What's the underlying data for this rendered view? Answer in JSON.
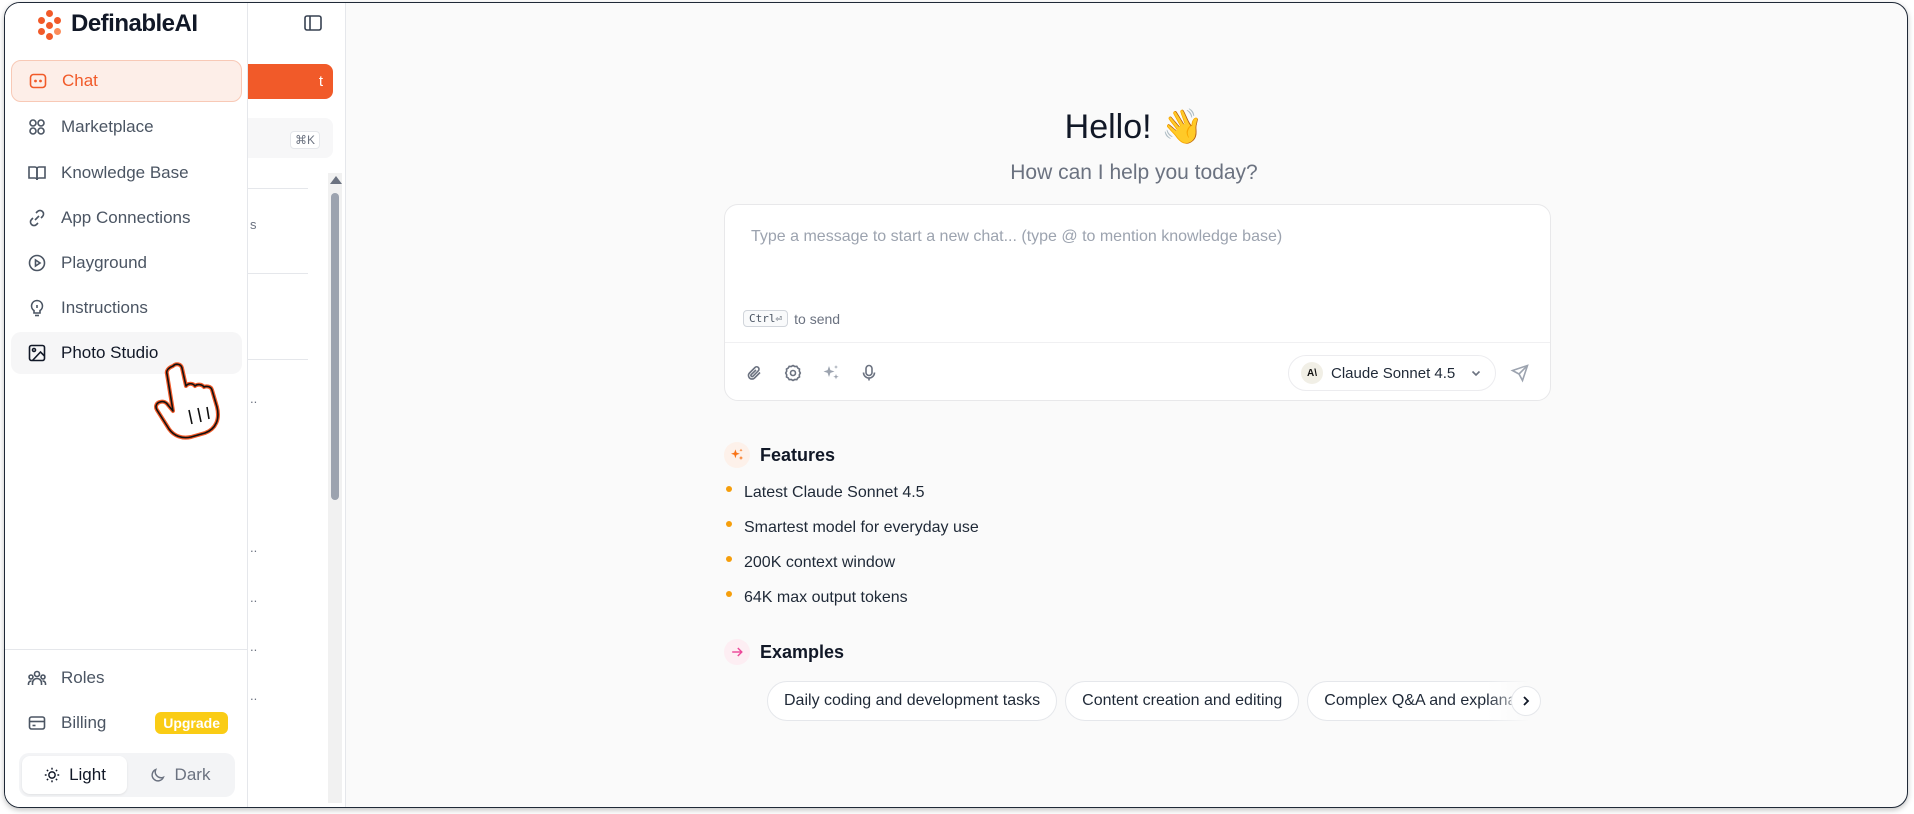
{
  "app": {
    "name": "DefinableAI"
  },
  "nav": {
    "items": [
      {
        "label": "Chat",
        "icon": "chat-bubble-icon",
        "state": "active"
      },
      {
        "label": "Marketplace",
        "icon": "grid-icon"
      },
      {
        "label": "Knowledge Base",
        "icon": "book-open-icon"
      },
      {
        "label": "App Connections",
        "icon": "link-icon"
      },
      {
        "label": "Playground",
        "icon": "play-circle-icon"
      },
      {
        "label": "Instructions",
        "icon": "lightbulb-icon"
      },
      {
        "label": "Photo Studio",
        "icon": "image-icon",
        "state": "hover"
      }
    ],
    "bottom": [
      {
        "label": "Roles",
        "icon": "users-icon"
      },
      {
        "label": "Billing",
        "icon": "credit-card-icon",
        "badge": "Upgrade"
      }
    ],
    "theme": {
      "light_label": "Light",
      "dark_label": "Dark",
      "selected": "Light"
    }
  },
  "panel": {
    "new_chat_fragment": "t",
    "search_shortcut": "⌘K",
    "fragments": [
      "s",
      "..",
      "..",
      "..",
      "..",
      ".."
    ]
  },
  "main": {
    "greeting": "Hello! 👋",
    "subtitle": "How can I help you today?",
    "composer": {
      "placeholder": "Type a message to start a new chat... (type @ to mention knowledge base)",
      "send_key": "Ctrl⏎",
      "send_hint": "to send",
      "model": {
        "name": "Claude Sonnet 4.5",
        "logo_text": "A\\"
      }
    },
    "features": {
      "title": "Features",
      "items": [
        "Latest Claude Sonnet 4.5",
        "Smartest model for everyday use",
        "200K context window",
        "64K max output tokens"
      ]
    },
    "examples": {
      "title": "Examples",
      "items": [
        "Daily coding and development tasks",
        "Content creation and editing",
        "Complex Q&A and explanations"
      ]
    }
  },
  "colors": {
    "accent": "#f15a29",
    "active_bg": "#fdeee8",
    "upgrade": "#facc15",
    "bullet": "#f59e0b"
  }
}
